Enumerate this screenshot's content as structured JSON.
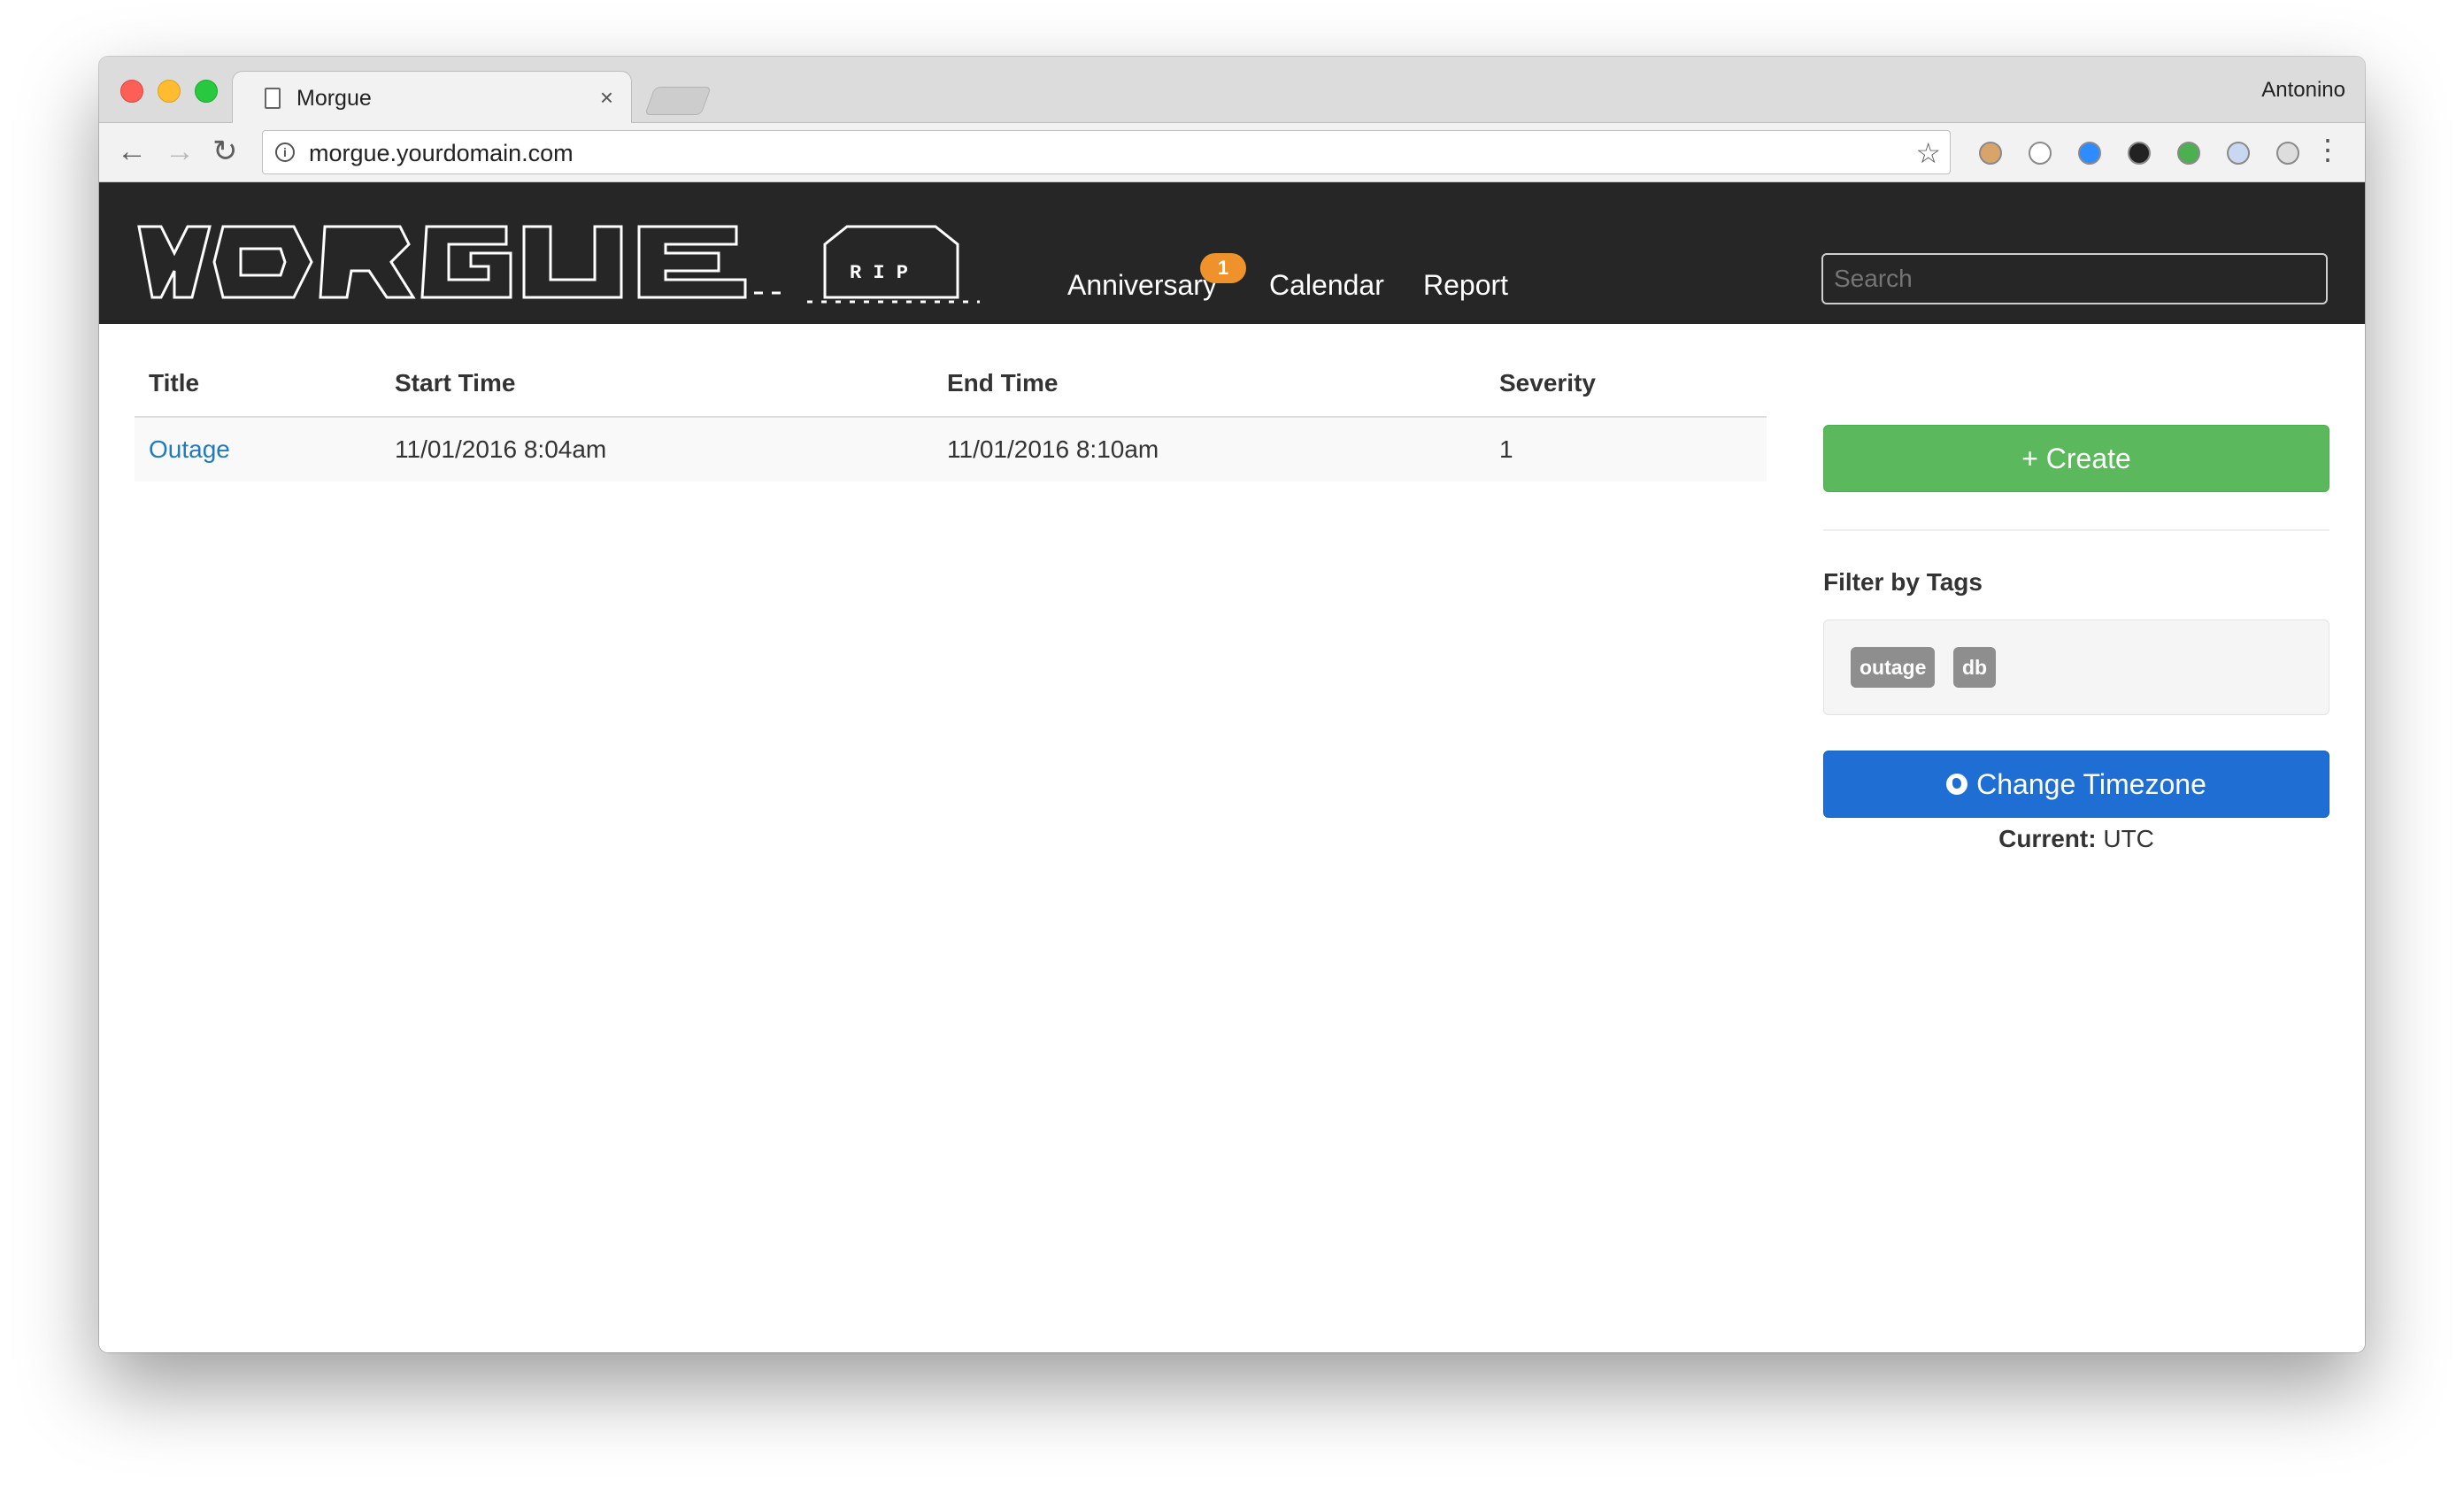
{
  "browser": {
    "tab_title": "Morgue",
    "tab_close": "×",
    "profile_name": "Antonino",
    "url": "morgue.yourdomain.com",
    "extensions": [
      {
        "name": "ext-tan",
        "color": "#d9a46a"
      },
      {
        "name": "ext-block",
        "color": "#ffffff"
      },
      {
        "name": "ext-blue",
        "color": "#2d8cff"
      },
      {
        "name": "ext-dark",
        "color": "#222222"
      },
      {
        "name": "ext-green",
        "color": "#4caf50"
      },
      {
        "name": "ext-flag",
        "color": "#c8d8f0"
      },
      {
        "name": "ext-gray",
        "color": "#dddddd"
      }
    ]
  },
  "navbar": {
    "links": [
      "Anniversary",
      "Calendar",
      "Report"
    ],
    "anniversary_badge": "1",
    "search_placeholder": "Search"
  },
  "table": {
    "headers": [
      "Title",
      "Start Time",
      "End Time",
      "Severity"
    ],
    "rows": [
      {
        "title": "Outage",
        "start": "11/01/2016 8:04am",
        "end": "11/01/2016 8:10am",
        "severity": "1"
      }
    ]
  },
  "sidebar": {
    "create_label": "+ Create",
    "filter_title": "Filter by Tags",
    "tags": [
      "outage",
      "db"
    ],
    "timezone_button": "Change Timezone",
    "current_label": "Current:",
    "current_value": "UTC"
  },
  "colors": {
    "navbar_bg": "#262626",
    "create_green": "#5cb85c",
    "timezone_blue": "#1f6ed4",
    "badge_orange": "#f0922c",
    "link_blue": "#1f7bc0",
    "tag_gray": "#8e8e8e"
  }
}
